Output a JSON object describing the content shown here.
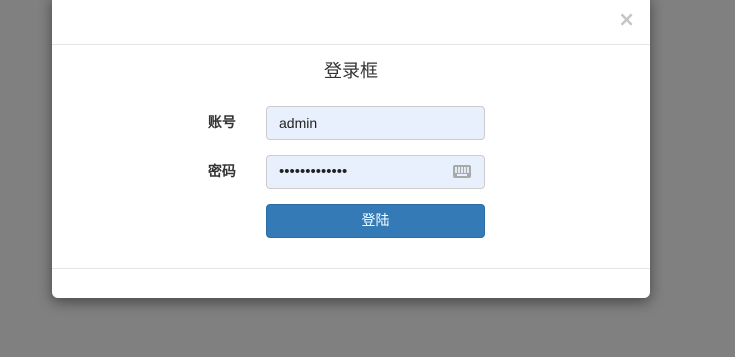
{
  "modal": {
    "close_symbol": "×",
    "close_icon": "close-icon",
    "title": "登录框"
  },
  "form": {
    "account_label": "账号",
    "account_value": "admin",
    "password_label": "密码",
    "password_value": "•••••••••••••",
    "keyboard_icon": "keyboard-icon",
    "submit_label": "登陆"
  },
  "colors": {
    "backdrop": "#808080",
    "primary_button": "#337ab7",
    "autofill_input": "#e8f0fe"
  }
}
